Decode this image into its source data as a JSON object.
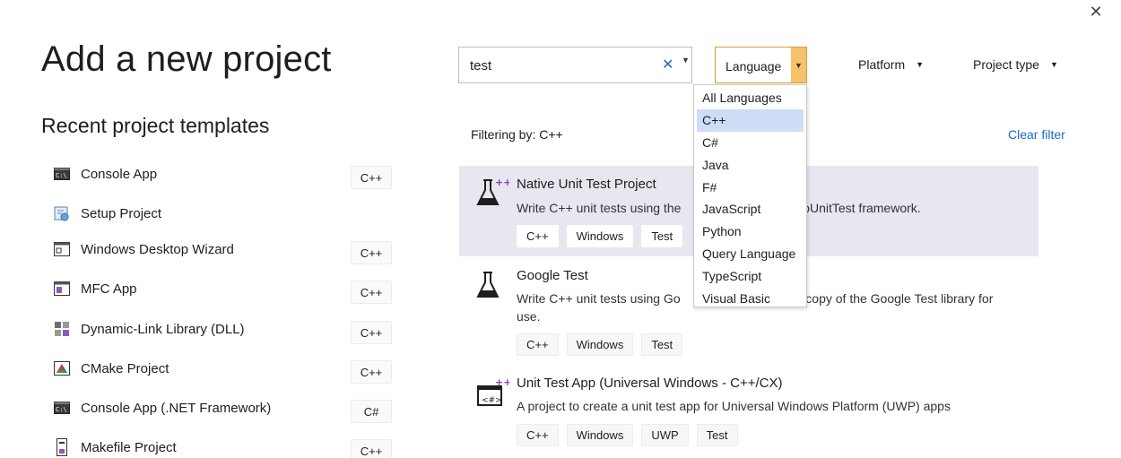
{
  "title": "Add a new project",
  "recent": {
    "heading": "Recent project templates",
    "items": [
      {
        "name": "Console App",
        "lang": "C++",
        "icon": "console-icon"
      },
      {
        "name": "Setup Project",
        "lang": "",
        "icon": "setup-project-icon"
      },
      {
        "name": "Windows Desktop Wizard",
        "lang": "C++",
        "icon": "windows-desktop-icon"
      },
      {
        "name": "MFC App",
        "lang": "C++",
        "icon": "mfc-app-icon"
      },
      {
        "name": "Dynamic-Link Library (DLL)",
        "lang": "C++",
        "icon": "dll-icon"
      },
      {
        "name": "CMake Project",
        "lang": "C++",
        "icon": "cmake-icon"
      },
      {
        "name": "Console App (.NET Framework)",
        "lang": "C#",
        "icon": "console-icon"
      },
      {
        "name": "Makefile Project",
        "lang": "C++",
        "icon": "makefile-icon"
      }
    ]
  },
  "search": {
    "value": "test",
    "clear_icon": "close-icon",
    "dropdown_icon": "chevron-down-icon"
  },
  "filters": {
    "language": {
      "label": "Language",
      "dropdown_icon": "chevron-down-icon"
    },
    "platform": {
      "label": "Platform"
    },
    "project_type": {
      "label": "Project type"
    }
  },
  "filtering_label": "Filtering by: C++",
  "clear_filter": "Clear filter",
  "language_options": [
    "All Languages",
    "C++",
    "C#",
    "Java",
    "F#",
    "JavaScript",
    "Python",
    "Query Language",
    "TypeScript",
    "Visual Basic"
  ],
  "highlighted_option": "C++",
  "results": [
    {
      "title": "Native Unit Test Project",
      "description": "Write C++ unit tests using the CppUnitTest framework.",
      "description_visible_left": "Write C++ unit tests using the",
      "description_visible_right": "ppUnitTest framework.",
      "tags": [
        "C++",
        "Windows",
        "Test"
      ],
      "icon": "flask-icon"
    },
    {
      "title": "Google Test",
      "description_visible_left": "Write C++ unit tests using Go",
      "description_visible_right": "a copy of the Google Test library for",
      "description_line2": "use.",
      "tags": [
        "C++",
        "Windows",
        "Test"
      ],
      "icon": "flask-icon"
    },
    {
      "title": "Unit Test App (Universal Windows - C++/CX)",
      "description": "A project to create a unit test app for Universal Windows Platform (UWP) apps",
      "tags": [
        "C++",
        "Windows",
        "UWP",
        "Test"
      ],
      "icon": "unit-test-app-icon"
    }
  ],
  "colors": {
    "accent": "#f6c26a",
    "link": "#1a6bc4",
    "selected_row": "#e6e7ef",
    "highlight": "#cfdcf6"
  }
}
